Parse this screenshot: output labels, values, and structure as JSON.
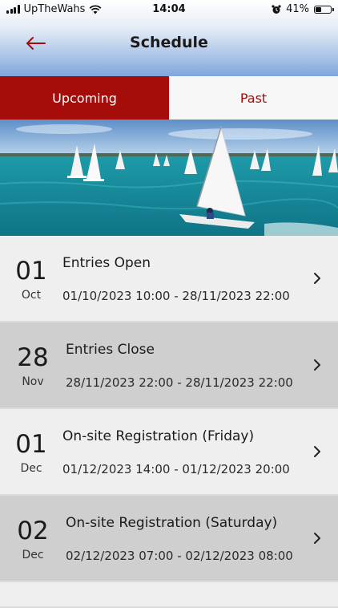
{
  "status_bar": {
    "carrier": "UpTheWahs",
    "time": "14:04",
    "battery": "41%",
    "battery_level": 0.41
  },
  "header": {
    "title": "Schedule"
  },
  "tabs": [
    {
      "label": "Upcoming",
      "active": true
    },
    {
      "label": "Past",
      "active": false
    }
  ],
  "colors": {
    "accent": "#a50d0a",
    "row_light": "#efefef",
    "row_dark": "#cfcfcf"
  },
  "events": [
    {
      "day": "01",
      "month": "Oct",
      "title": "Entries Open",
      "dates": "01/10/2023 10:00 - 28/11/2023 22:00"
    },
    {
      "day": "28",
      "month": "Nov",
      "title": "Entries Close",
      "dates": "28/11/2023 22:00 - 28/11/2023 22:00"
    },
    {
      "day": "01",
      "month": "Dec",
      "title": "On-site Registration (Friday)",
      "dates": "01/12/2023 14:00 - 01/12/2023 20:00"
    },
    {
      "day": "02",
      "month": "Dec",
      "title": "On-site Registration (Saturday)",
      "dates": "02/12/2023 07:00 - 02/12/2023 08:00"
    }
  ],
  "icons": {
    "back": "arrow-left-icon",
    "chevron": "chevron-right-icon",
    "wifi": "wifi-icon",
    "alarm": "alarm-icon"
  }
}
